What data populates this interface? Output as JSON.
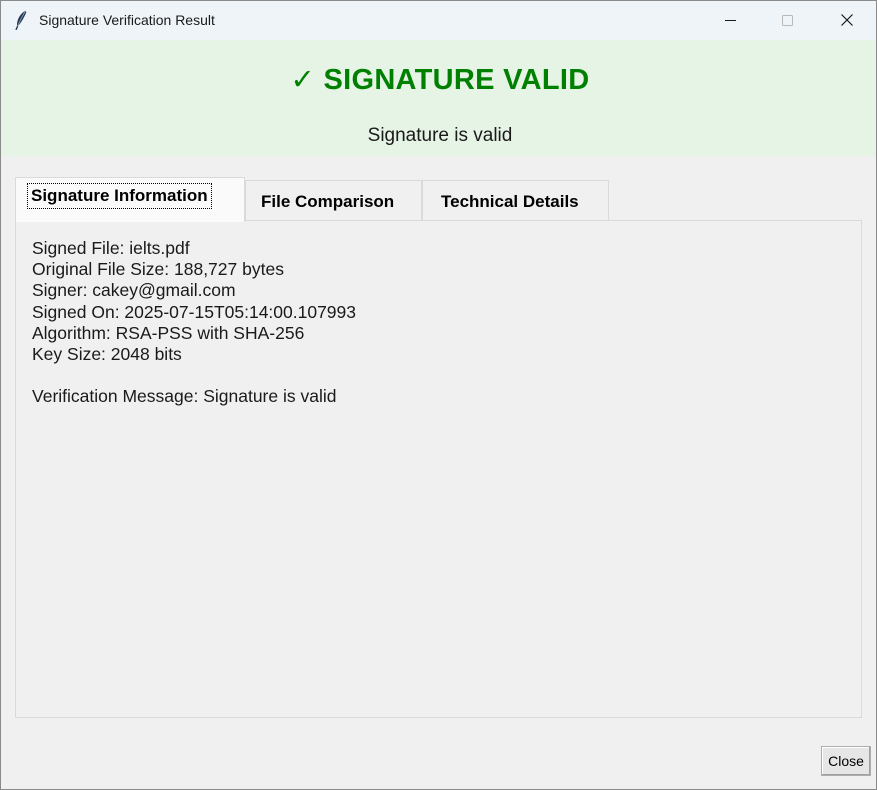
{
  "window": {
    "title": "Signature Verification Result"
  },
  "banner": {
    "status": "✓ SIGNATURE VALID",
    "message": "Signature is valid",
    "status_color": "#008000",
    "background": "#e6f4e6"
  },
  "tabs": [
    {
      "label": "Signature Information",
      "selected": true
    },
    {
      "label": "File Comparison",
      "selected": false
    },
    {
      "label": "Technical Details",
      "selected": false
    }
  ],
  "signature_info": {
    "signed_file": "Signed File: ielts.pdf",
    "original_file_size": "Original File Size: 188,727 bytes",
    "signer": "Signer: cakey@gmail.com",
    "signed_on": "Signed On: 2025-07-15T05:14:00.107993",
    "algorithm": "Algorithm: RSA-PSS with SHA-256",
    "key_size": "Key Size: 2048 bits",
    "verification_message": "Verification Message: Signature is valid"
  },
  "footer": {
    "close_label": "Close"
  },
  "icons": {
    "app": "feather-icon",
    "minimize": "minimize-icon",
    "maximize": "maximize-icon",
    "close": "close-icon"
  }
}
